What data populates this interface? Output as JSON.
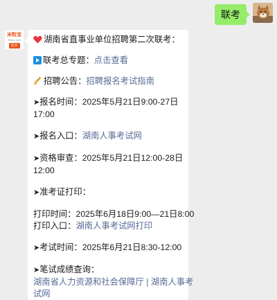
{
  "outgoing": {
    "text": "联考"
  },
  "incoming": {
    "avatar": {
      "brand": "米粒宝",
      "sub": "mlbao.com",
      "city": "长沙"
    },
    "title": "湖南省直事业单位招聘第二次联考：",
    "topic_label": "联考总专题：",
    "topic_link": "点击查看",
    "notice_label": "招聘公告：",
    "notice_link": "招聘报名考试指南",
    "arrow": "➤",
    "signup_time_1": "报名时间：2025年5月21日9:00-27日",
    "signup_time_2": "17:00",
    "signup_entry_label": "报名入口：",
    "signup_entry_link": "湖南人事考试网",
    "review_1": "资格审查：2025年5月21日12:00-28日",
    "review_2": "12:00",
    "admit_title": "准考证打印：",
    "print_time": "打印时间：2025年6月18日9:00—21日8:00",
    "print_entry_label": "打印入口：",
    "print_entry_link": "湖南人事考试网打印",
    "exam_time": "考试时间：2025年6月21日8:30-12:00",
    "score_title": "笔试成绩查询：",
    "score_link_1": "湖南省人力资源和社会保障厅",
    "score_sep": " | ",
    "score_link_2a": "湖南人事考",
    "score_link_2b": "试网"
  },
  "icons": {
    "heart": "heart-icon",
    "play": "play-icon",
    "writing": "writing-hand-icon"
  },
  "colors": {
    "background": "#ededed",
    "outgoing_bubble": "#95ec69",
    "link": "#576b95",
    "heart": "#e8353b",
    "play": "#1a8fe0"
  }
}
